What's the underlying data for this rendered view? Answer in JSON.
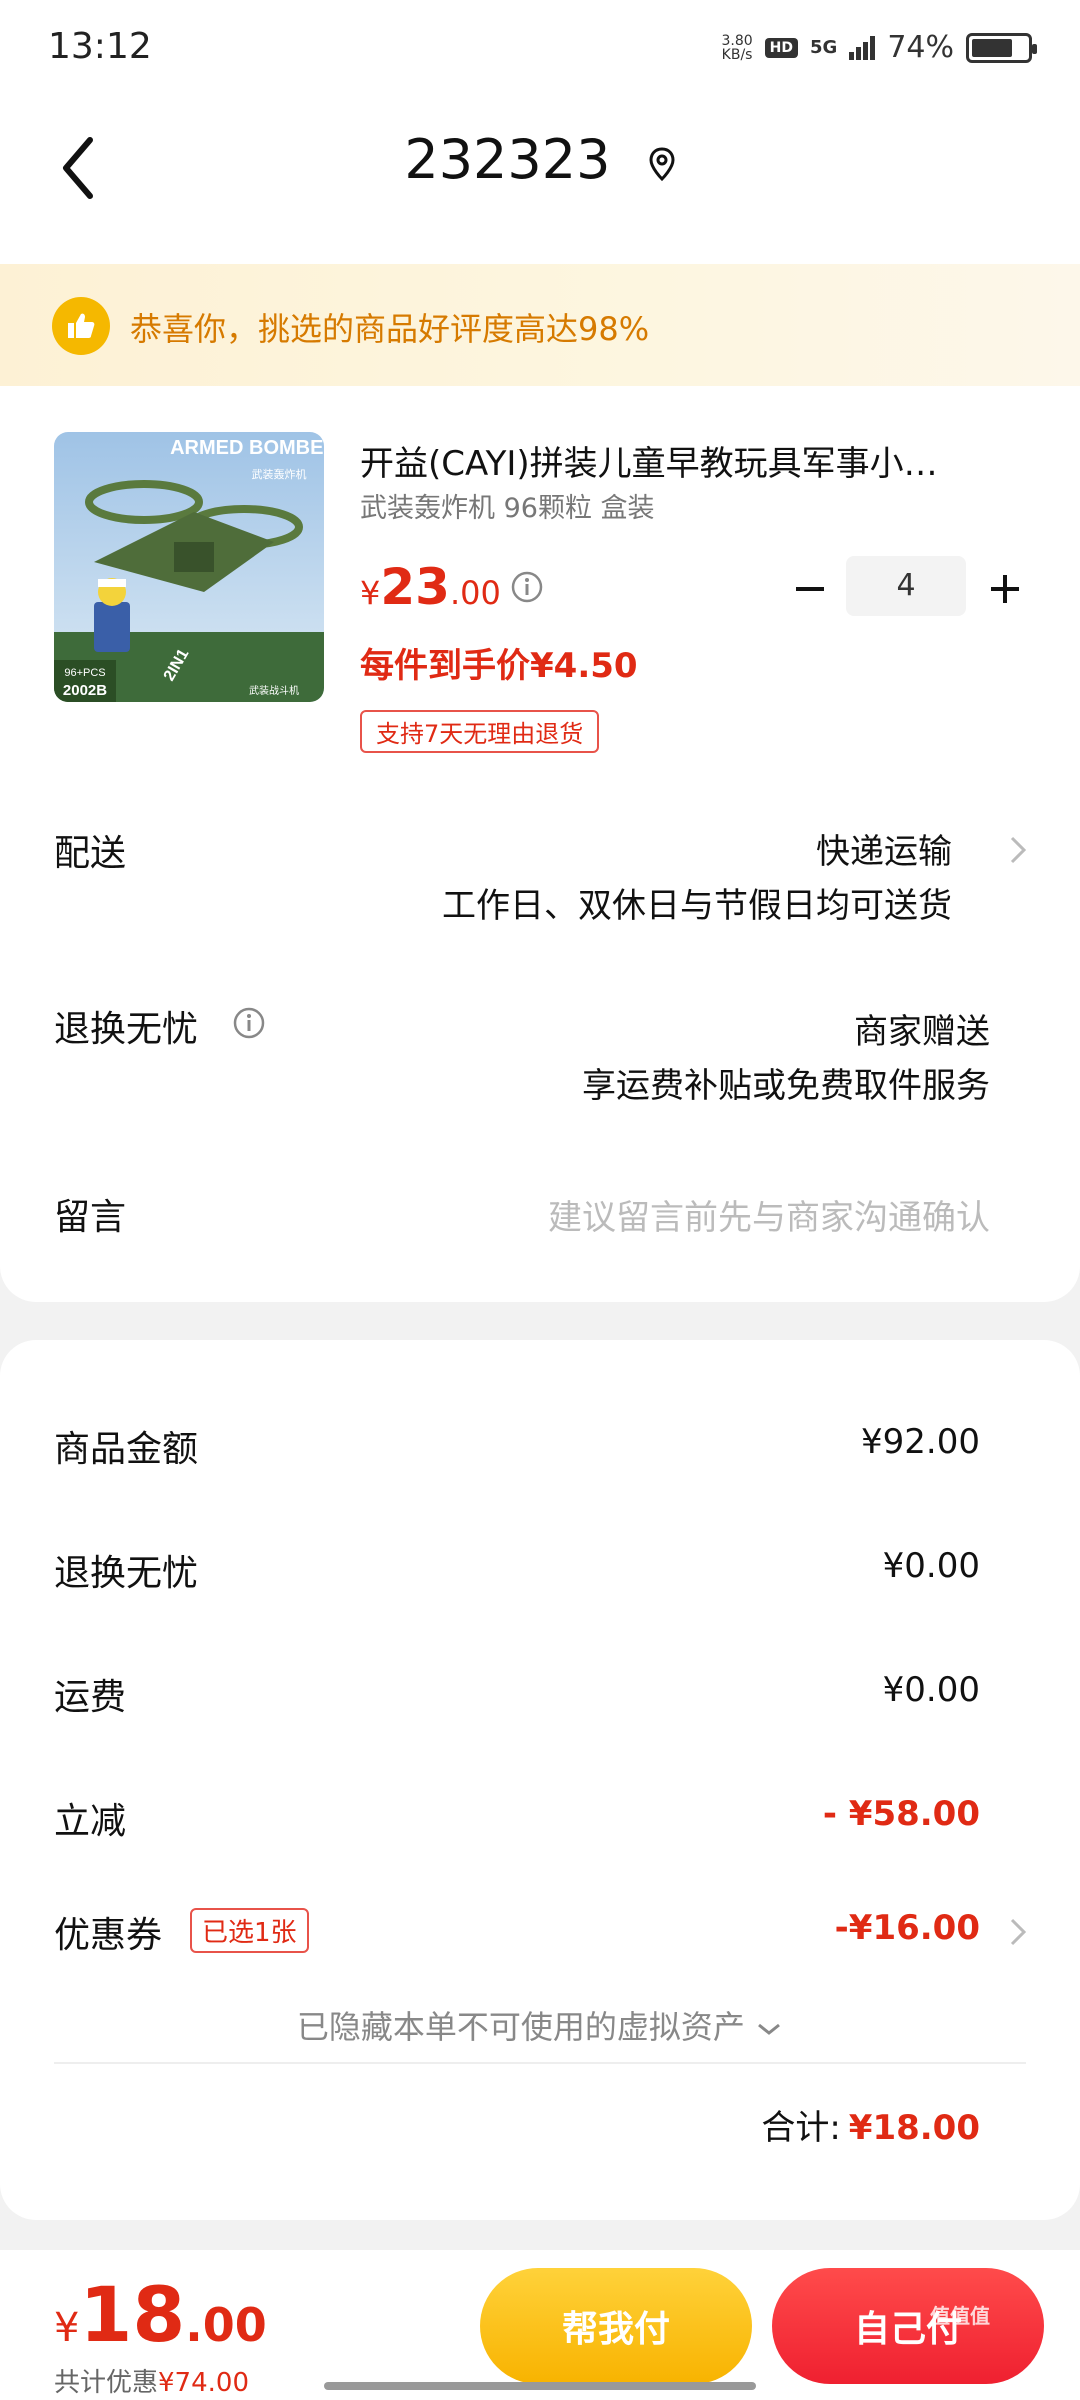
{
  "status_bar": {
    "time": "13:12",
    "net_speed_value": "3.80",
    "net_speed_unit": "KB/s",
    "hd_label": "HD",
    "network": "5G",
    "battery": "74%",
    "battery_level": 0.74
  },
  "header": {
    "title": "232323",
    "back_icon": "chevron-left-icon",
    "location_icon": "location-pin-icon"
  },
  "banner": {
    "icon": "thumbs-up-icon",
    "text": "恭喜你，挑选的商品好评度高达98%"
  },
  "product": {
    "image_text_top": "ARMED BOMBER",
    "image_text_cn": "武装轰炸机",
    "image_badge_pcs": "96+PCS",
    "image_badge_code": "2002B",
    "image_badge_2in1": "2IN1",
    "image_badge_bottom": "武装战斗机",
    "name": "开益(CAYI)拼装儿童早教玩具军事小…",
    "spec": "武装轰炸机 96颗粒 盒装",
    "price_currency": "¥",
    "price_integer": "23",
    "price_decimal": ".00",
    "unit_price": "每件到手价¥4.50",
    "return_badge": "支持7天无理由退货",
    "quantity": "4"
  },
  "delivery": {
    "label": "配送",
    "value": "快递运输",
    "sub": "工作日、双休日与节假日均可送货"
  },
  "worry_free": {
    "label": "退换无忧",
    "value": "商家赠送",
    "sub": "享运费补贴或免费取件服务"
  },
  "message": {
    "label": "留言",
    "placeholder": "建议留言前先与商家沟通确认"
  },
  "summary": {
    "goods_label": "商品金额",
    "goods_value": "¥92.00",
    "worry_label": "退换无忧",
    "worry_value": "¥0.00",
    "shipping_label": "运费",
    "shipping_value": "¥0.00",
    "discount_label": "立减",
    "discount_value": "- ¥58.00",
    "coupon_label": "优惠券",
    "coupon_badge": "已选1张",
    "coupon_value": "-¥16.00",
    "hidden_assets": "已隐藏本单不可使用的虚拟资产",
    "total_label": "合计:",
    "total_value": "¥18.00"
  },
  "bottom_bar": {
    "price_currency": "¥",
    "price_integer": "18",
    "price_decimal": ".00",
    "saved_label": "共计优惠",
    "saved_value": "¥74.00",
    "help_pay_button": "帮我付",
    "self_pay_button": "自己付"
  },
  "watermark": "值值值",
  "colors": {
    "accent_red": "#e02a14",
    "banner_orange": "#d67a00",
    "help_button_yellow": "#f8b300",
    "self_button_red": "#ef2030"
  }
}
